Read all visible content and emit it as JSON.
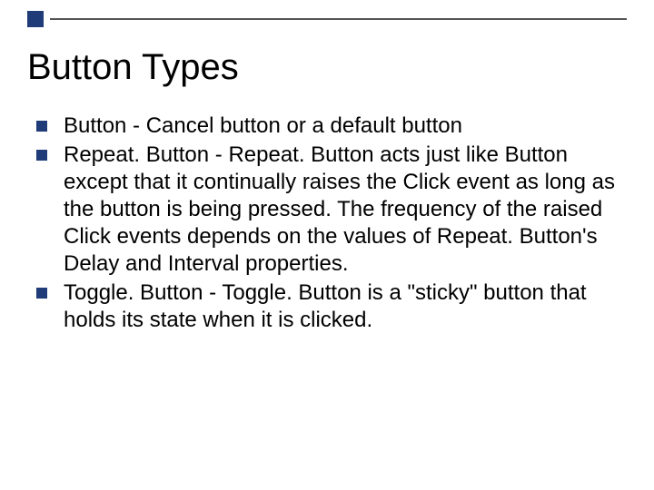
{
  "slide": {
    "title": "Button Types",
    "bullets": [
      {
        "text": "Button - Cancel button or a default button"
      },
      {
        "text": "Repeat. Button - Repeat. Button acts just like Button except that it continually raises the Click event as long as the button is being pressed. The frequency of the raised Click events depends on the values of Repeat. Button's Delay and Interval properties."
      },
      {
        "text": "Toggle. Button - Toggle. Button is a \"sticky\" button that holds its state when it is clicked."
      }
    ]
  }
}
